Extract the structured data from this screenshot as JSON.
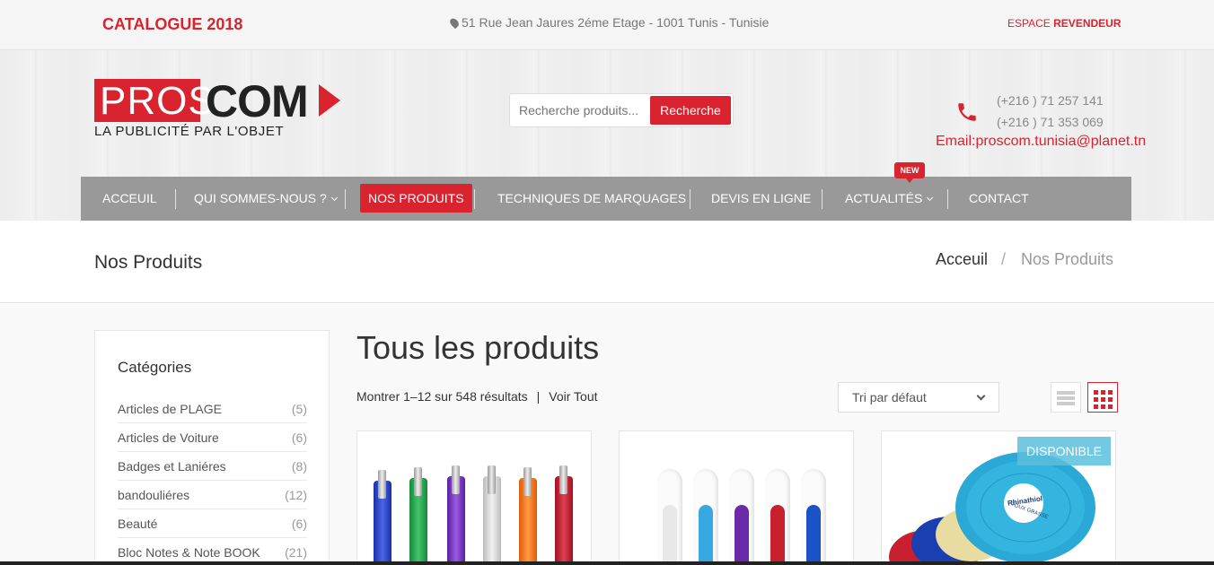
{
  "topbar": {
    "catalogue": "CATALOGUE 2018",
    "address": "51 Rue Jean Jaures 2éme Etage - 1001 Tunis - Tunisie",
    "revendeur_prefix": "ESPACE ",
    "revendeur_bold": "REVENDEUR"
  },
  "logo": {
    "pros": "PROS",
    "com": "COM",
    "tagline": "LA PUBLICITÉ PAR L'OBJET"
  },
  "search": {
    "placeholder": "Recherche produits...",
    "button": "Recherche"
  },
  "contact": {
    "phone1": "(+216 ) 71 257 141",
    "phone2": "(+216 ) 71 353 069",
    "email": "Email:proscom.tunisia@planet.tn"
  },
  "nav": {
    "items": [
      {
        "label": "ACCEUIL"
      },
      {
        "label": "QUI SOMMES-NOUS ?"
      },
      {
        "label": "NOS PRODUITS",
        "active": true
      },
      {
        "label": "TECHNIQUES DE MARQUAGES"
      },
      {
        "label": "DEVIS EN LIGNE"
      },
      {
        "label": "ACTUALITÉS"
      },
      {
        "label": "CONTACT"
      }
    ],
    "new_badge": "NEW"
  },
  "page": {
    "title": "Nos Produits",
    "breadcrumb": [
      "Acceuil",
      "/",
      "Nos Produits"
    ]
  },
  "sidebar": {
    "title": "Catégories",
    "categories": [
      {
        "name": "Articles de PLAGE",
        "count": "(5)"
      },
      {
        "name": "Articles de Voiture",
        "count": "(6)"
      },
      {
        "name": "Badges et Laniéres",
        "count": "(8)"
      },
      {
        "name": "bandouliéres",
        "count": "(12)"
      },
      {
        "name": "Beauté",
        "count": "(6)"
      },
      {
        "name": "Bloc Notes & Note BOOK",
        "count": "(21)"
      }
    ]
  },
  "main": {
    "title": "Tous les produits",
    "results": "Montrer 1–12 sur 548 résultats",
    "separator": "|",
    "view_all": "Voir Tout",
    "sort_selected": "Tri par défaut",
    "badge": "DISPONIBLE",
    "product3_logo": "Rhinathiol",
    "product3_sub": "TOUX GRASSE"
  },
  "colors": {
    "brand_red": "#d9232e",
    "nav_gray": "#999999",
    "badge_blue": "#5bc0de"
  }
}
